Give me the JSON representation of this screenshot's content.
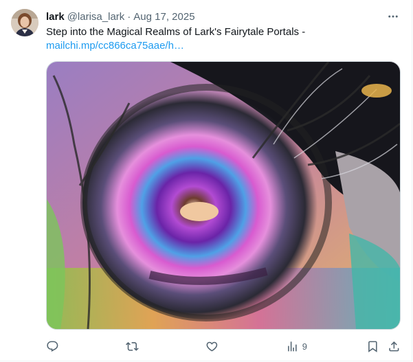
{
  "tweet": {
    "author_name": "lark",
    "handle": "@larisa_lark",
    "separator": "·",
    "date": "Aug 17, 2025",
    "text": "Step into the Magical Realms of Lark's Fairytale Portals -",
    "link_text": "mailchi.mp/cc866ca75aae/h…",
    "media_description": "painting of a swirling rainbow portal framed by dark trees",
    "icons": {
      "avatar": "avatar-photo",
      "more": "more-dots-icon",
      "reply": "reply-icon",
      "retweet": "retweet-icon",
      "like": "heart-icon",
      "views": "views-chart-icon",
      "bookmark": "bookmark-icon",
      "share": "share-icon"
    },
    "stats": {
      "views": "9"
    }
  },
  "colors": {
    "text": "#0f1419",
    "secondary": "#536471",
    "link": "#1d9bf0",
    "border": "#cfd9de"
  }
}
